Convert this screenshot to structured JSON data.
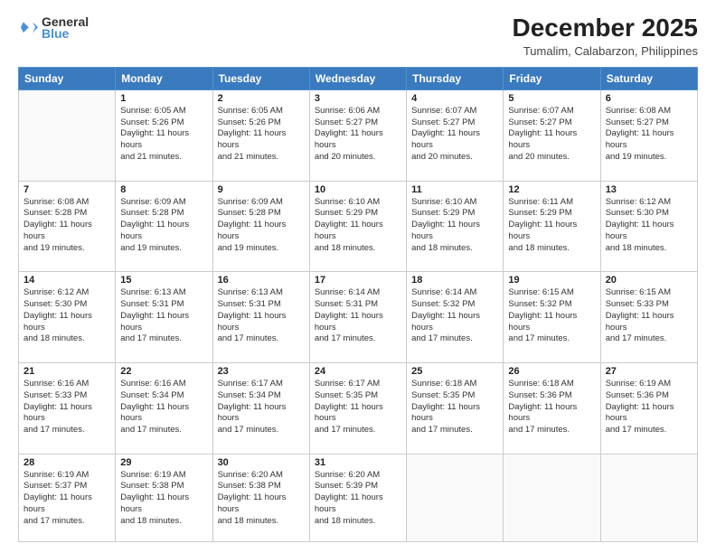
{
  "header": {
    "logo_general": "General",
    "logo_blue": "Blue",
    "month": "December 2025",
    "location": "Tumalim, Calabarzon, Philippines"
  },
  "days_of_week": [
    "Sunday",
    "Monday",
    "Tuesday",
    "Wednesday",
    "Thursday",
    "Friday",
    "Saturday"
  ],
  "weeks": [
    [
      {
        "day": "",
        "sunrise": "",
        "sunset": "",
        "daylight": ""
      },
      {
        "day": "1",
        "sunrise": "Sunrise: 6:05 AM",
        "sunset": "Sunset: 5:26 PM",
        "daylight": "Daylight: 11 hours and 21 minutes."
      },
      {
        "day": "2",
        "sunrise": "Sunrise: 6:05 AM",
        "sunset": "Sunset: 5:26 PM",
        "daylight": "Daylight: 11 hours and 21 minutes."
      },
      {
        "day": "3",
        "sunrise": "Sunrise: 6:06 AM",
        "sunset": "Sunset: 5:27 PM",
        "daylight": "Daylight: 11 hours and 20 minutes."
      },
      {
        "day": "4",
        "sunrise": "Sunrise: 6:07 AM",
        "sunset": "Sunset: 5:27 PM",
        "daylight": "Daylight: 11 hours and 20 minutes."
      },
      {
        "day": "5",
        "sunrise": "Sunrise: 6:07 AM",
        "sunset": "Sunset: 5:27 PM",
        "daylight": "Daylight: 11 hours and 20 minutes."
      },
      {
        "day": "6",
        "sunrise": "Sunrise: 6:08 AM",
        "sunset": "Sunset: 5:27 PM",
        "daylight": "Daylight: 11 hours and 19 minutes."
      }
    ],
    [
      {
        "day": "7",
        "sunrise": "Sunrise: 6:08 AM",
        "sunset": "Sunset: 5:28 PM",
        "daylight": "Daylight: 11 hours and 19 minutes."
      },
      {
        "day": "8",
        "sunrise": "Sunrise: 6:09 AM",
        "sunset": "Sunset: 5:28 PM",
        "daylight": "Daylight: 11 hours and 19 minutes."
      },
      {
        "day": "9",
        "sunrise": "Sunrise: 6:09 AM",
        "sunset": "Sunset: 5:28 PM",
        "daylight": "Daylight: 11 hours and 19 minutes."
      },
      {
        "day": "10",
        "sunrise": "Sunrise: 6:10 AM",
        "sunset": "Sunset: 5:29 PM",
        "daylight": "Daylight: 11 hours and 18 minutes."
      },
      {
        "day": "11",
        "sunrise": "Sunrise: 6:10 AM",
        "sunset": "Sunset: 5:29 PM",
        "daylight": "Daylight: 11 hours and 18 minutes."
      },
      {
        "day": "12",
        "sunrise": "Sunrise: 6:11 AM",
        "sunset": "Sunset: 5:29 PM",
        "daylight": "Daylight: 11 hours and 18 minutes."
      },
      {
        "day": "13",
        "sunrise": "Sunrise: 6:12 AM",
        "sunset": "Sunset: 5:30 PM",
        "daylight": "Daylight: 11 hours and 18 minutes."
      }
    ],
    [
      {
        "day": "14",
        "sunrise": "Sunrise: 6:12 AM",
        "sunset": "Sunset: 5:30 PM",
        "daylight": "Daylight: 11 hours and 18 minutes."
      },
      {
        "day": "15",
        "sunrise": "Sunrise: 6:13 AM",
        "sunset": "Sunset: 5:31 PM",
        "daylight": "Daylight: 11 hours and 17 minutes."
      },
      {
        "day": "16",
        "sunrise": "Sunrise: 6:13 AM",
        "sunset": "Sunset: 5:31 PM",
        "daylight": "Daylight: 11 hours and 17 minutes."
      },
      {
        "day": "17",
        "sunrise": "Sunrise: 6:14 AM",
        "sunset": "Sunset: 5:31 PM",
        "daylight": "Daylight: 11 hours and 17 minutes."
      },
      {
        "day": "18",
        "sunrise": "Sunrise: 6:14 AM",
        "sunset": "Sunset: 5:32 PM",
        "daylight": "Daylight: 11 hours and 17 minutes."
      },
      {
        "day": "19",
        "sunrise": "Sunrise: 6:15 AM",
        "sunset": "Sunset: 5:32 PM",
        "daylight": "Daylight: 11 hours and 17 minutes."
      },
      {
        "day": "20",
        "sunrise": "Sunrise: 6:15 AM",
        "sunset": "Sunset: 5:33 PM",
        "daylight": "Daylight: 11 hours and 17 minutes."
      }
    ],
    [
      {
        "day": "21",
        "sunrise": "Sunrise: 6:16 AM",
        "sunset": "Sunset: 5:33 PM",
        "daylight": "Daylight: 11 hours and 17 minutes."
      },
      {
        "day": "22",
        "sunrise": "Sunrise: 6:16 AM",
        "sunset": "Sunset: 5:34 PM",
        "daylight": "Daylight: 11 hours and 17 minutes."
      },
      {
        "day": "23",
        "sunrise": "Sunrise: 6:17 AM",
        "sunset": "Sunset: 5:34 PM",
        "daylight": "Daylight: 11 hours and 17 minutes."
      },
      {
        "day": "24",
        "sunrise": "Sunrise: 6:17 AM",
        "sunset": "Sunset: 5:35 PM",
        "daylight": "Daylight: 11 hours and 17 minutes."
      },
      {
        "day": "25",
        "sunrise": "Sunrise: 6:18 AM",
        "sunset": "Sunset: 5:35 PM",
        "daylight": "Daylight: 11 hours and 17 minutes."
      },
      {
        "day": "26",
        "sunrise": "Sunrise: 6:18 AM",
        "sunset": "Sunset: 5:36 PM",
        "daylight": "Daylight: 11 hours and 17 minutes."
      },
      {
        "day": "27",
        "sunrise": "Sunrise: 6:19 AM",
        "sunset": "Sunset: 5:36 PM",
        "daylight": "Daylight: 11 hours and 17 minutes."
      }
    ],
    [
      {
        "day": "28",
        "sunrise": "Sunrise: 6:19 AM",
        "sunset": "Sunset: 5:37 PM",
        "daylight": "Daylight: 11 hours and 17 minutes."
      },
      {
        "day": "29",
        "sunrise": "Sunrise: 6:19 AM",
        "sunset": "Sunset: 5:38 PM",
        "daylight": "Daylight: 11 hours and 18 minutes."
      },
      {
        "day": "30",
        "sunrise": "Sunrise: 6:20 AM",
        "sunset": "Sunset: 5:38 PM",
        "daylight": "Daylight: 11 hours and 18 minutes."
      },
      {
        "day": "31",
        "sunrise": "Sunrise: 6:20 AM",
        "sunset": "Sunset: 5:39 PM",
        "daylight": "Daylight: 11 hours and 18 minutes."
      },
      {
        "day": "",
        "sunrise": "",
        "sunset": "",
        "daylight": ""
      },
      {
        "day": "",
        "sunrise": "",
        "sunset": "",
        "daylight": ""
      },
      {
        "day": "",
        "sunrise": "",
        "sunset": "",
        "daylight": ""
      }
    ]
  ]
}
